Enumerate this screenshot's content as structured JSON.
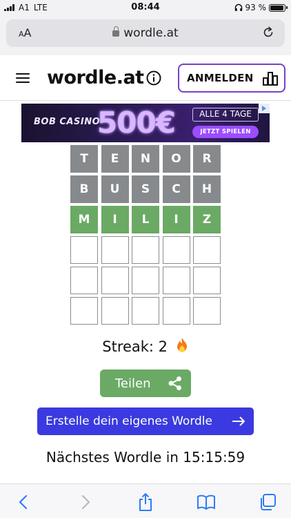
{
  "status_bar": {
    "carrier": "A1",
    "network": "LTE",
    "time": "08:44",
    "battery_percent_label": "93 %",
    "battery_level": 0.93
  },
  "browser": {
    "text_size_label_small": "A",
    "text_size_label_large": "A",
    "url": "wordle.at"
  },
  "header": {
    "logo": "wordle.at",
    "login_label": "ANMELDEN"
  },
  "ad": {
    "brand": "BOB CASINO",
    "amount": "500€",
    "days": "ALLE 4 TAGE",
    "cta": "JETZT SPIELEN"
  },
  "board": {
    "rows": [
      [
        {
          "letter": "T",
          "state": "absent"
        },
        {
          "letter": "E",
          "state": "absent"
        },
        {
          "letter": "N",
          "state": "absent"
        },
        {
          "letter": "O",
          "state": "absent"
        },
        {
          "letter": "R",
          "state": "absent"
        }
      ],
      [
        {
          "letter": "B",
          "state": "absent"
        },
        {
          "letter": "U",
          "state": "absent"
        },
        {
          "letter": "S",
          "state": "absent"
        },
        {
          "letter": "C",
          "state": "absent"
        },
        {
          "letter": "H",
          "state": "absent"
        }
      ],
      [
        {
          "letter": "M",
          "state": "correct"
        },
        {
          "letter": "I",
          "state": "correct"
        },
        {
          "letter": "L",
          "state": "correct"
        },
        {
          "letter": "I",
          "state": "correct"
        },
        {
          "letter": "Z",
          "state": "correct"
        }
      ],
      [
        {
          "letter": "",
          "state": "empty"
        },
        {
          "letter": "",
          "state": "empty"
        },
        {
          "letter": "",
          "state": "empty"
        },
        {
          "letter": "",
          "state": "empty"
        },
        {
          "letter": "",
          "state": "empty"
        }
      ],
      [
        {
          "letter": "",
          "state": "empty"
        },
        {
          "letter": "",
          "state": "empty"
        },
        {
          "letter": "",
          "state": "empty"
        },
        {
          "letter": "",
          "state": "empty"
        },
        {
          "letter": "",
          "state": "empty"
        }
      ],
      [
        {
          "letter": "",
          "state": "empty"
        },
        {
          "letter": "",
          "state": "empty"
        },
        {
          "letter": "",
          "state": "empty"
        },
        {
          "letter": "",
          "state": "empty"
        },
        {
          "letter": "",
          "state": "empty"
        }
      ]
    ]
  },
  "streak": {
    "label": "Streak: 2"
  },
  "share": {
    "label": "Teilen"
  },
  "create": {
    "label": "Erstelle dein eigenes Wordle"
  },
  "next": {
    "label": "Nächstes Wordle in 15:15:59"
  },
  "colors": {
    "correct": "#6aaa64",
    "absent": "#878a8c",
    "accent_purple": "#7b3fc6",
    "create_blue": "#3a3ae0",
    "ios_blue": "#2f7bf5"
  },
  "icons": {
    "menu": "hamburger-icon",
    "info": "info-icon",
    "leaderboard": "leaderboard-icon",
    "share": "share-icon",
    "arrow": "arrow-right-icon",
    "reload": "reload-icon",
    "lock": "lock-icon",
    "flame": "flame-icon",
    "back": "back-icon",
    "forward": "forward-icon",
    "share_sheet": "share-sheet-icon",
    "bookmarks": "bookmarks-icon",
    "tabs": "tabs-icon"
  }
}
